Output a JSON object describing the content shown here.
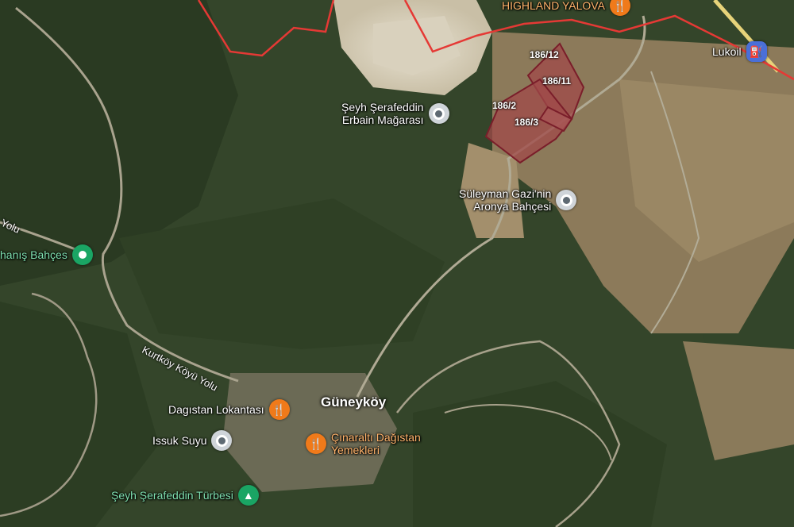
{
  "pois": {
    "highland": {
      "label": "HIGHLAND YALOVA",
      "icon": "restaurant-icon"
    },
    "lukoil": {
      "label": "Lukoil",
      "icon": "gas-station-icon"
    },
    "cave": {
      "line1": "Şeyh Şerafeddin",
      "line2": "Erbain Mağarası",
      "icon": "place-pin-icon"
    },
    "aronya": {
      "line1": "Süleyman Gazi'nin",
      "line2": "Aronya Bahçesi",
      "icon": "place-pin-icon"
    },
    "garden": {
      "label": "hanış Bahçes",
      "icon": "park-pin-icon"
    },
    "lokanta": {
      "label": "Dagıstan Lokantası",
      "icon": "restaurant-icon"
    },
    "cinaralti": {
      "line1": "Çınaraltı Dağıstan",
      "line2": "Yemekleri",
      "icon": "restaurant-icon"
    },
    "issuk": {
      "label": "Issuk Suyu",
      "icon": "place-pin-icon"
    },
    "turbe": {
      "label": "Şeyh Şerafeddin Türbesi",
      "icon": "tree-pin-icon"
    }
  },
  "town": {
    "label": "Güneyköy"
  },
  "roads": {
    "kurtkoy": "Kurtköy Köyü Yolu",
    "yolu": "Yolu"
  },
  "parcels": [
    "186/12",
    "186/11",
    "186/2",
    "186/3"
  ],
  "colors": {
    "boundary": "#e53935",
    "parcel_fill": "#a04a4a",
    "parcel_stroke": "#7a1e2a",
    "restaurant": "#f07a1a",
    "park": "#1aa564",
    "gas": "#4a6fd8"
  }
}
